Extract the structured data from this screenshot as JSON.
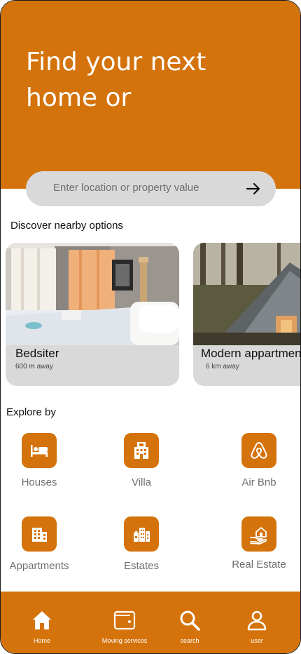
{
  "hero": {
    "title": "Find your next home or"
  },
  "search": {
    "placeholder": "Enter location or property value",
    "submit_icon": "arrow-right-icon"
  },
  "nearby": {
    "heading": "Discover nearby options",
    "cards": [
      {
        "name": "Bedsiter",
        "distance": "600 m away"
      },
      {
        "name": "Modern appartment",
        "distance": "6 km away"
      }
    ]
  },
  "explore": {
    "heading": "Explore by",
    "categories": [
      {
        "label": "Houses",
        "icon": "bed-icon"
      },
      {
        "label": "Villa",
        "icon": "villa-icon"
      },
      {
        "label": "Air Bnb",
        "icon": "airbnb-icon"
      },
      {
        "label": "Appartments",
        "icon": "apartment-building-icon"
      },
      {
        "label": "Estates",
        "icon": "estate-buildings-icon"
      },
      {
        "label": "Real Estate",
        "icon": "house-in-hand-icon"
      }
    ]
  },
  "nav": {
    "items": [
      {
        "label": "Home",
        "icon": "home-icon"
      },
      {
        "label": "Moving services",
        "icon": "wallet-icon"
      },
      {
        "label": "search",
        "icon": "search-icon"
      },
      {
        "label": "user",
        "icon": "user-icon"
      }
    ]
  },
  "colors": {
    "accent": "#d4730b",
    "card_bg": "#d9d9d9",
    "muted_text": "#6e6e6e"
  }
}
